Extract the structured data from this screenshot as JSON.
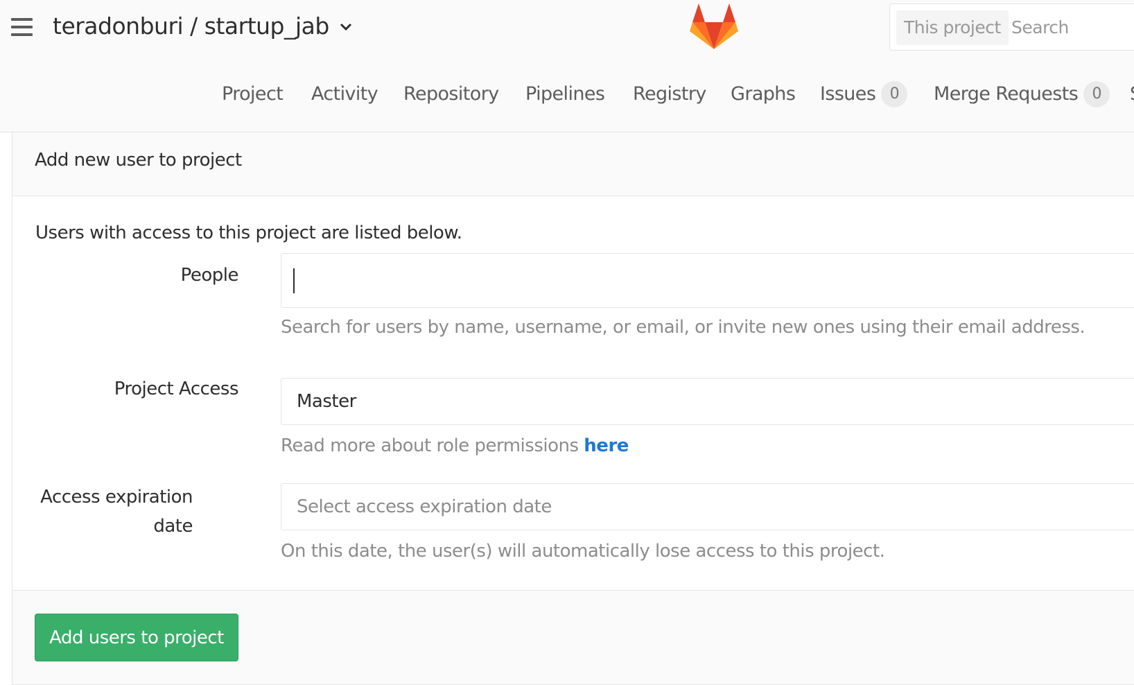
{
  "header": {
    "project_path": "teradonburi / startup_jab",
    "search_scope": "This project",
    "search_placeholder": "Search"
  },
  "nav": {
    "items": [
      {
        "label": "Project"
      },
      {
        "label": "Activity"
      },
      {
        "label": "Repository"
      },
      {
        "label": "Pipelines"
      },
      {
        "label": "Registry"
      },
      {
        "label": "Graphs"
      },
      {
        "label": "Issues",
        "count": "0"
      },
      {
        "label": "Merge Requests",
        "count": "0"
      },
      {
        "label": "S"
      }
    ]
  },
  "panel": {
    "title": "Add new user to project",
    "intro": "Users with access to this project are listed below.",
    "people": {
      "label": "People",
      "value": "",
      "help": "Search for users by name, username, or email, or invite new ones using their email address."
    },
    "access": {
      "label": "Project Access",
      "value": "Master",
      "help": "Read more about role permissions",
      "link": "here"
    },
    "expiration": {
      "label": "Access expiration date",
      "placeholder": "Select access expiration date",
      "help": "On this date, the user(s) will automatically lose access to this project."
    },
    "submit": "Add users to project"
  },
  "colors": {
    "primary_button": "#3aaf6a",
    "link": "#1f78d1"
  }
}
